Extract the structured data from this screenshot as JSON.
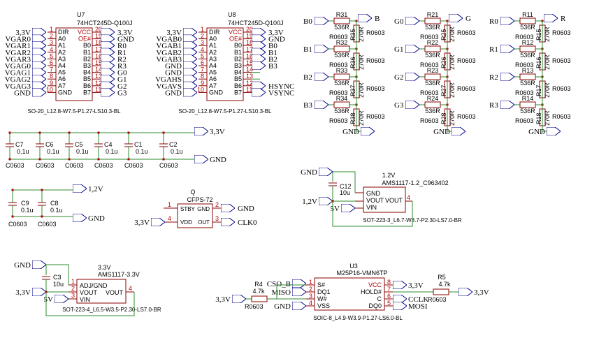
{
  "u7": {
    "ref": "U7",
    "part": "74HCT245D-Q100J",
    "fp": "SO-20_L12.8-W7.5-P1.27-LS10.3-BL",
    "left_pins": [
      "DIR",
      "A0",
      "A1",
      "A2",
      "A3",
      "A4",
      "A5",
      "A6",
      "A7",
      "GND"
    ],
    "left_nums": [
      "1",
      "2",
      "3",
      "4",
      "5",
      "6",
      "7",
      "8",
      "9",
      "10"
    ],
    "right_pins": [
      "VCC",
      "OE#",
      "B0",
      "B1",
      "B2",
      "B3",
      "B4",
      "B5",
      "B6",
      "B7"
    ],
    "right_nums": [
      "20",
      "19",
      "18",
      "17",
      "16",
      "15",
      "14",
      "13",
      "12",
      "11"
    ],
    "left_nets": [
      "3,3V",
      "VGAR0",
      "VGAR1",
      "VGAR2",
      "VGAR3",
      "VGAG0",
      "VGAG1",
      "VGAG2",
      "VGAG3",
      "GND"
    ],
    "right_nets": [
      "3,3V",
      "GND",
      "R0",
      "R1",
      "R2",
      "R3",
      "G0",
      "G1",
      "G2",
      "G3"
    ]
  },
  "u8": {
    "ref": "U8",
    "part": "74HCT245D-Q100J",
    "fp": "SO-20_L12.8-W7.5-P1.27-LS10.3-BL",
    "left_nets": [
      "3,3V",
      "VGAB0",
      "VGAB1",
      "VGAB2",
      "VGAB3",
      "GND",
      "GND",
      "VGAHS",
      "VGAVS",
      "GND"
    ],
    "right_nets": [
      "3,3V",
      "GND",
      "B0",
      "B1",
      "B2",
      "B3",
      "",
      "",
      "HSYNC",
      "VSYNC"
    ]
  },
  "dac": {
    "cols": [
      {
        "in": [
          "B0",
          "B1",
          "B2",
          "B3"
        ],
        "refs": [
          "R31",
          "R32",
          "R33",
          "R34"
        ],
        "shunt": [
          "R35",
          "R36",
          "R37",
          "R38"
        ],
        "out": "B"
      },
      {
        "in": [
          "G0",
          "G1",
          "G2",
          "G3"
        ],
        "refs": [
          "R21",
          "R22",
          "R23",
          "R24"
        ],
        "shunt": [
          "R25",
          "R26",
          "R27",
          "R28"
        ],
        "out": "G"
      },
      {
        "in": [
          "R0",
          "R1",
          "R2",
          "R3"
        ],
        "refs": [
          "R11",
          "R12",
          "R13",
          "R14"
        ],
        "shunt": [
          "R15",
          "R16",
          "R17",
          "R18"
        ],
        "out": "R"
      }
    ],
    "series_val": "536R",
    "pkg": "R0603",
    "shunt_val": "270R",
    "gnd": "GND"
  },
  "caps_row1": {
    "refs": [
      "C7",
      "C6",
      "C5",
      "C4",
      "C1",
      "C2"
    ],
    "val": "0.1u",
    "pkg": "C0603",
    "net_top": "3,3V",
    "net_bot": "GND"
  },
  "caps_row2": {
    "refs": [
      "C9",
      "C8"
    ],
    "val": "0.1u",
    "pkg": "C0603",
    "net_top": "1,2V",
    "net_bot": "GND"
  },
  "osc": {
    "ref": "Q",
    "part": "CFPS-72",
    "pins_l": [
      "STBY",
      "VDD"
    ],
    "pins_r": [
      "GND",
      "OUT"
    ],
    "nums_l": [
      "1",
      "4"
    ],
    "nums_r": [
      "2",
      "3"
    ],
    "net_vdd": "3,3V",
    "net_gnd": "GND",
    "net_out": "CLK0"
  },
  "reg12": {
    "title": "1.2V",
    "part": "AMS1117-1.2_C963402",
    "pins": [
      "GND",
      "VOUT",
      "VIN"
    ],
    "vout2": "VOUT",
    "num": "4",
    "fp": "SOT-223-3_L6.7-W3.7-P2.30-LS7.0-BR",
    "cap": "C12",
    "capv": "10u",
    "gnd": "GND",
    "vout": "1,2V",
    "vin": "5V"
  },
  "reg33": {
    "title": "3.3V",
    "part": "AMS1117-3.3V",
    "pins": [
      "ADJ/GND",
      "VOUT",
      "VIN"
    ],
    "vout2": "VOUT",
    "nums": [
      "1",
      "2",
      "3",
      "4"
    ],
    "fp": "SOT-223-4_L6.5-W3.5-P2.30-LS7.0-BR",
    "cap": "C3",
    "capv": "10u",
    "gnd": "GND",
    "vout": "3,3V",
    "vin": "5V"
  },
  "flash": {
    "ref": "U3",
    "part": "M25P16-VMN6TP",
    "fp": "SOIC-8_L4.9-W3.9-P1.27-LS6.0-BL",
    "left_pins": [
      "S#",
      "DQ1",
      "W#",
      "VSS"
    ],
    "left_nums": [
      "1",
      "2",
      "3",
      "4"
    ],
    "right_pins": [
      "VCC",
      "HOLD#",
      "C",
      "DQ0"
    ],
    "right_nums": [
      "8",
      "7",
      "6",
      "5"
    ],
    "nets_l": [
      "CSO_B",
      "MISO",
      "GND"
    ],
    "nets_r": [
      "3,3V",
      "CCLK",
      "MOSI"
    ],
    "r4": {
      "ref": "R4",
      "val": "4.7k",
      "pkg": "R0603",
      "net": "3,3V"
    },
    "r5": {
      "ref": "R5",
      "val": "4.7k",
      "pkg": "R0603",
      "net": "3,3V"
    }
  }
}
